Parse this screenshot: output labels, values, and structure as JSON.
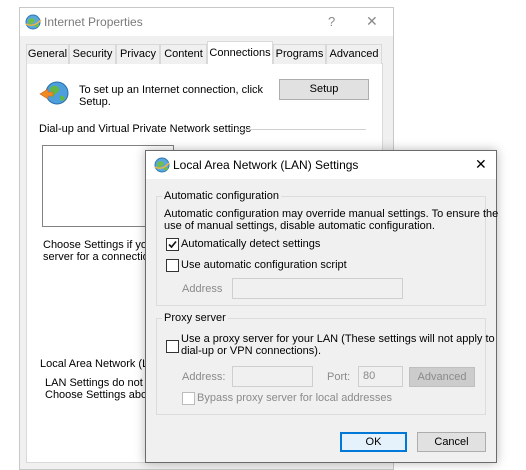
{
  "bg_window": {
    "title": "Internet Properties",
    "help_glyph": "?",
    "close_glyph": "✕",
    "tabs": [
      {
        "label": "General"
      },
      {
        "label": "Security"
      },
      {
        "label": "Privacy"
      },
      {
        "label": "Content"
      },
      {
        "label": "Connections"
      },
      {
        "label": "Programs"
      },
      {
        "label": "Advanced"
      }
    ],
    "active_tab": "Connections",
    "setup_text_1": "To set up an Internet connection, click",
    "setup_text_2": "Setup.",
    "setup_button": "Setup",
    "vpn_heading": "Dial-up and Virtual Private Network settings",
    "choose_text_1": "Choose Settings if you",
    "choose_text_2": "server for a connection",
    "lan_heading": "Local Area Network (LA",
    "lan_text_1": "LAN Settings do not ap",
    "lan_text_2": "Choose Settings above"
  },
  "dialog": {
    "title": "Local Area Network (LAN) Settings",
    "close_glyph": "✕",
    "auto_group_title": "Automatic configuration",
    "auto_desc_1": "Automatic configuration may override manual settings.  To ensure the",
    "auto_desc_2": "use of manual settings, disable automatic configuration.",
    "auto_detect_label": "Automatically detect settings",
    "auto_detect_checked": true,
    "auto_script_label": "Use automatic configuration script",
    "auto_script_checked": false,
    "address_label": "Address",
    "address_value": "",
    "proxy_group_title": "Proxy server",
    "proxy_use_label_1": "Use a proxy server for your LAN (These settings will not apply to",
    "proxy_use_label_2": "dial-up or VPN connections).",
    "proxy_use_checked": false,
    "proxy_address_label": "Address:",
    "proxy_address_value": "",
    "port_label": "Port:",
    "port_value": "80",
    "advanced_button": "Advanced",
    "bypass_label": "Bypass proxy server for local addresses",
    "bypass_checked": false,
    "ok_button": "OK",
    "cancel_button": "Cancel"
  },
  "colors": {
    "window_bg": "#f0f0f0",
    "accent_border": "#0078d7",
    "default_button_bg": "#e5f1fb"
  },
  "icons": {
    "window_icon": "internet-options-globe-icon",
    "setup_icon": "globe-arrow-icon",
    "dialog_icon": "internet-options-globe-icon"
  }
}
